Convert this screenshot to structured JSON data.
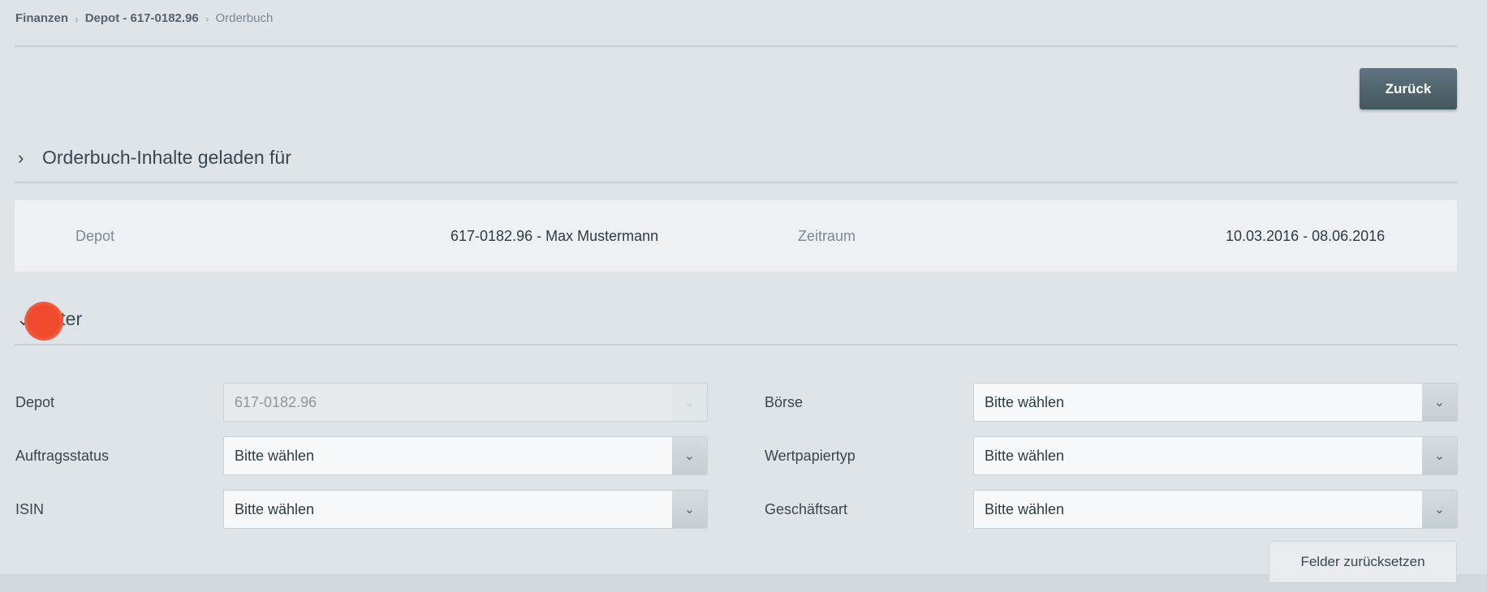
{
  "breadcrumb": {
    "items": [
      "Finanzen",
      "Depot - 617-0182.96",
      "Orderbuch"
    ]
  },
  "header": {
    "back_button": "Zurück"
  },
  "section_loaded": {
    "title": "Orderbuch-Inhalte geladen für",
    "depot_label": "Depot",
    "depot_value": "617-0182.96 - Max Mustermann",
    "period_label": "Zeitraum",
    "period_value": "10.03.2016 - 08.06.2016"
  },
  "section_filter": {
    "title": "Filter"
  },
  "filters": {
    "depot": {
      "label": "Depot",
      "value": "617-0182.96"
    },
    "auftragsstatus": {
      "label": "Auftragsstatus",
      "value": "Bitte wählen"
    },
    "isin": {
      "label": "ISIN",
      "value": "Bitte wählen"
    },
    "boerse": {
      "label": "Börse",
      "value": "Bitte wählen"
    },
    "wertpapiertyp": {
      "label": "Wertpapiertyp",
      "value": "Bitte wählen"
    },
    "geschaeftsart": {
      "label": "Geschäftsart",
      "value": "Bitte wählen"
    }
  },
  "reset_button": "Felder zurücksetzen",
  "colors": {
    "primary_button": "#4f636d",
    "background": "#dfe4e8",
    "cursor_indicator": "#f04a2e"
  }
}
